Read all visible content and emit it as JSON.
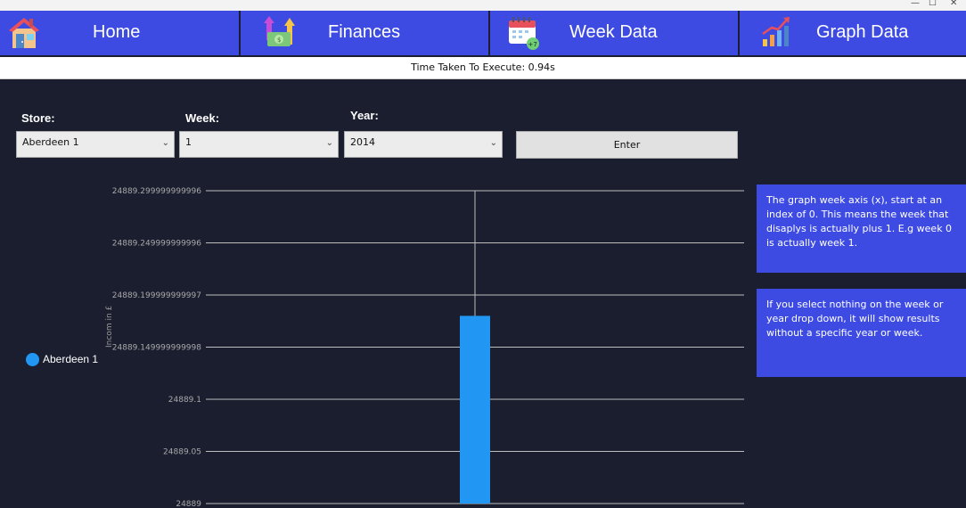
{
  "nav": {
    "tabs": [
      {
        "label": "Home",
        "icon": "house-icon"
      },
      {
        "label": "Finances",
        "icon": "money-growth-icon"
      },
      {
        "label": "Week Data",
        "icon": "calendar-plus7-icon"
      },
      {
        "label": "Graph Data",
        "icon": "bar-chart-icon"
      }
    ],
    "accent_color": "#3d4be3"
  },
  "status": {
    "execution_time_text": "Time Taken To Execute: 0.94s"
  },
  "filters": {
    "store_label": "Store:",
    "store_value": "Aberdeen 1",
    "week_label": "Week:",
    "week_value": "1",
    "year_label": "Year:",
    "year_value": "2014",
    "enter_label": "Enter"
  },
  "legend": {
    "series_name": "Aberdeen 1",
    "series_color": "#2196f3"
  },
  "info": {
    "note1": "The graph week axis (x), start at an index of 0. This means the week that disaplys is actually plus 1. E.g week 0 is actually week 1.",
    "note2": "If you select nothing on the week or year drop down, it will show results without a specific year or week."
  },
  "chart_data": {
    "type": "bar",
    "title": "",
    "xlabel": "",
    "ylabel": "Incom in £",
    "y_tick_labels": [
      "24889.299999999996",
      "24889.249999999996",
      "24889.199999999997",
      "24889.149999999998",
      "24889.1",
      "24889.05",
      "24889"
    ],
    "ylim": [
      24889,
      24889.3
    ],
    "series": [
      {
        "name": "Aberdeen 1",
        "values": [
          24889.18
        ]
      }
    ],
    "grid": true,
    "legend_position": "left",
    "bar_color": "#2196f3"
  }
}
